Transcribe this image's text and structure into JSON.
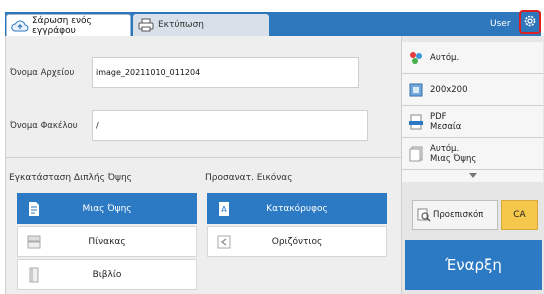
{
  "tabs": [
    {
      "label": "Σάρωση ενός εγγράφου",
      "icon": "cloud-upload-icon"
    },
    {
      "label": "Εκτύπωση",
      "icon": "printer-icon"
    }
  ],
  "header": {
    "user": "User",
    "settings_icon": "gear-icon"
  },
  "form": {
    "file_name_label": "Όνομα Αρχείου",
    "file_name_value": "image_20211010_011204",
    "folder_name_label": "Όνομα Φακέλου",
    "folder_name_value": "/"
  },
  "duplex": {
    "title": "Εγκατάσταση Διπλής Όψης",
    "options": [
      {
        "label": "Μιας Όψης",
        "icon": "single-page-icon",
        "selected": true
      },
      {
        "label": "Πίνακας",
        "icon": "tablet-flip-icon",
        "selected": false
      },
      {
        "label": "Βιβλίο",
        "icon": "book-icon",
        "selected": false
      }
    ]
  },
  "orientation": {
    "title": "Προσανατ. Εικόνας",
    "options": [
      {
        "label": "Κατακόρυφος",
        "icon": "portrait-icon",
        "selected": true
      },
      {
        "label": "Οριζόντιος",
        "icon": "landscape-icon",
        "selected": false
      }
    ]
  },
  "side_settings": [
    {
      "line1": "Αυτόμ.",
      "line2": "",
      "icon": "color-mode-icon"
    },
    {
      "line1": "200x200",
      "line2": "",
      "icon": "resolution-icon"
    },
    {
      "line1": "PDF",
      "line2": "Μεσαία",
      "icon": "file-format-icon"
    },
    {
      "line1": "Αυτόμ.",
      "line2": "Μιας Όψης",
      "icon": "paper-size-icon"
    }
  ],
  "buttons": {
    "preview": "Προεπισκόπ",
    "ca": "CA",
    "start": "Έναρξη"
  },
  "colors": {
    "accent": "#2d7ac4",
    "header": "#2f77bd",
    "ca": "#f5c74b",
    "highlight": "#e02020"
  }
}
